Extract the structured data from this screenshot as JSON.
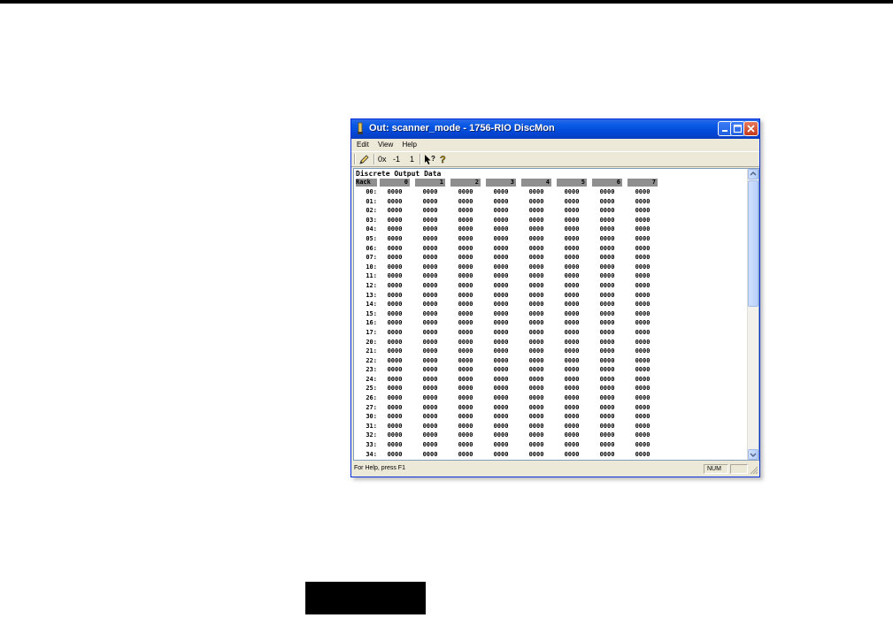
{
  "window": {
    "title": "Out: scanner_mode - 1756-RIO DiscMon",
    "colors": {
      "titlebar": "#0a5ae6",
      "header_bg": "#8f8f8f"
    }
  },
  "menu": [
    {
      "label": "Edit"
    },
    {
      "label": "View"
    },
    {
      "label": "Help"
    }
  ],
  "toolbar": {
    "edit_icon": "pencil-icon",
    "radix_label": "0x",
    "minus_label": "-1",
    "plus_label": "1",
    "help_icon": "context-help-icon",
    "about_icon": "about-icon"
  },
  "data": {
    "heading": "Discrete Output Data",
    "rack_label": "Rack",
    "columns": [
      "0",
      "1",
      "2",
      "3",
      "4",
      "5",
      "6",
      "7"
    ],
    "rows": [
      "00:",
      "01:",
      "02:",
      "03:",
      "04:",
      "05:",
      "06:",
      "07:",
      "10:",
      "11:",
      "12:",
      "13:",
      "14:",
      "15:",
      "16:",
      "17:",
      "20:",
      "21:",
      "22:",
      "23:",
      "24:",
      "25:",
      "26:",
      "27:",
      "30:",
      "31:",
      "32:",
      "33:",
      "34:"
    ],
    "cell_value": "0000"
  },
  "status": {
    "help_text": "For Help, press F1",
    "num_indicator": "NUM"
  }
}
